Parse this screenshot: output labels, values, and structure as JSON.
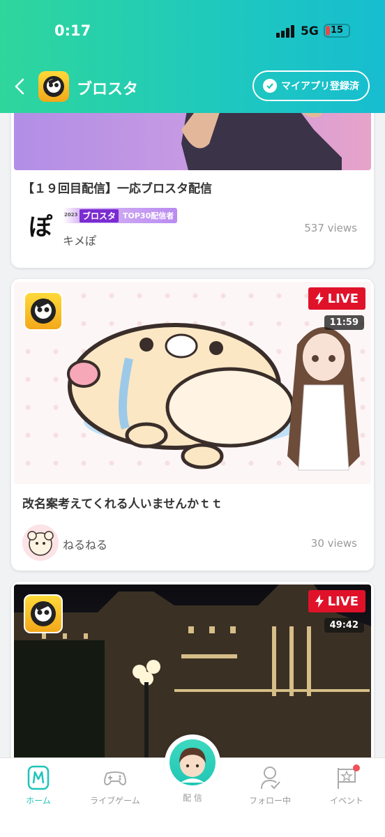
{
  "status_bar": {
    "time": "0:17",
    "network": "5G",
    "battery": "15"
  },
  "header": {
    "title": "ブロスタ",
    "register_label": "マイアプリ登録済"
  },
  "posts": [
    {
      "title": "【１９回目配信】一応ブロスタ配信",
      "author": "キメぽ",
      "author_avatar_text": "ぽ",
      "views": "537 views",
      "badge": {
        "year": "2023",
        "game": "ブロスタ",
        "rank": "TOP30配信者"
      }
    },
    {
      "title": "改名案考えてくれる人いませんかｔｔ",
      "author": "ねるねる",
      "views": "30 views",
      "live": "LIVE",
      "duration": "11:59"
    },
    {
      "live": "LIVE",
      "duration": "49:42"
    }
  ],
  "bottom_nav": {
    "home": "ホーム",
    "live_game": "ライブゲーム",
    "broadcast": "配 信",
    "following": "フォロー中",
    "event": "イベント"
  },
  "colors": {
    "accent": "#1fc4b8",
    "live_red": "#e0122a",
    "header_start": "#2fd69c",
    "header_end": "#17bdd0"
  }
}
